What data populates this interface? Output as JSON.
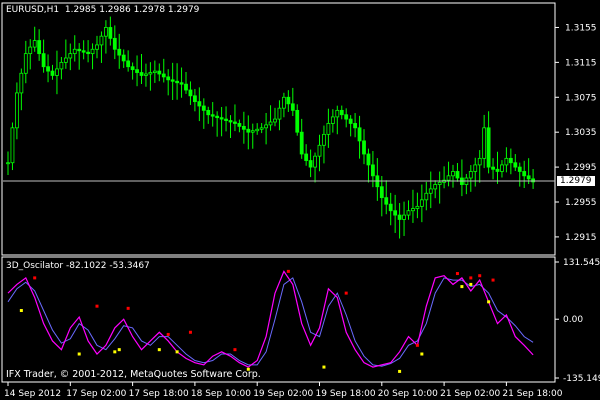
{
  "main_chart": {
    "symbol_label": "EURUSD,H1",
    "ohlc_label": "1.2985 1.2986 1.2978 1.2979",
    "price_ticks": [
      "1.3155",
      "1.3115",
      "1.3075",
      "1.3035",
      "1.2995",
      "1.2955",
      "1.2915"
    ],
    "current_price": "1.2979",
    "colors": {
      "candle": "#00ff00",
      "frame": "#ffffff",
      "price_line": "#c0c0c0"
    },
    "price_range": [
      1.29,
      1.3175
    ],
    "price_path": [
      [
        0,
        1.3
      ],
      [
        2,
        1.308
      ],
      [
        4,
        1.3125
      ],
      [
        6,
        1.314
      ],
      [
        8,
        1.311
      ],
      [
        10,
        1.31
      ],
      [
        12,
        1.3115
      ],
      [
        15,
        1.313
      ],
      [
        18,
        1.3125
      ],
      [
        20,
        1.3135
      ],
      [
        22,
        1.3155
      ],
      [
        24,
        1.313
      ],
      [
        27,
        1.311
      ],
      [
        30,
        1.31
      ],
      [
        33,
        1.3105
      ],
      [
        36,
        1.3095
      ],
      [
        39,
        1.309
      ],
      [
        42,
        1.307
      ],
      [
        45,
        1.3055
      ],
      [
        48,
        1.305
      ],
      [
        51,
        1.3045
      ],
      [
        54,
        1.3035
      ],
      [
        57,
        1.304
      ],
      [
        60,
        1.305
      ],
      [
        62,
        1.3075
      ],
      [
        64,
        1.306
      ],
      [
        66,
        1.301
      ],
      [
        68,
        1.2995
      ],
      [
        70,
        1.302
      ],
      [
        72,
        1.3045
      ],
      [
        74,
        1.306
      ],
      [
        76,
        1.305
      ],
      [
        78,
        1.304
      ],
      [
        80,
        1.301
      ],
      [
        82,
        1.2985
      ],
      [
        84,
        1.296
      ],
      [
        86,
        1.2945
      ],
      [
        88,
        1.2935
      ],
      [
        90,
        1.2945
      ],
      [
        92,
        1.295
      ],
      [
        94,
        1.2965
      ],
      [
        96,
        1.2975
      ],
      [
        98,
        1.298
      ],
      [
        100,
        1.299
      ],
      [
        102,
        1.2975
      ],
      [
        104,
        1.299
      ],
      [
        106,
        1.3005
      ],
      [
        107,
        1.304
      ],
      [
        108,
        1.2995
      ],
      [
        110,
        1.299
      ],
      [
        112,
        1.3005
      ],
      [
        114,
        1.2995
      ],
      [
        116,
        1.2985
      ],
      [
        118,
        1.2978
      ]
    ]
  },
  "indicator": {
    "title": "3D_Oscilator -82.1022 -53.3467",
    "ticks": [
      "131.5455",
      "0.00",
      "-135.1492"
    ],
    "range": [
      -135.1492,
      131.5455
    ],
    "colors": {
      "main_line": "#ff00ff",
      "signal_line": "#6a6aff",
      "buy_dot": "#ffff00",
      "sell_dot": "#ff0000"
    },
    "main_line": [
      [
        0,
        60
      ],
      [
        2,
        80
      ],
      [
        4,
        95
      ],
      [
        6,
        50
      ],
      [
        8,
        -10
      ],
      [
        10,
        -50
      ],
      [
        12,
        -70
      ],
      [
        14,
        -20
      ],
      [
        16,
        5
      ],
      [
        18,
        -50
      ],
      [
        20,
        -80
      ],
      [
        22,
        -60
      ],
      [
        24,
        -20
      ],
      [
        26,
        0
      ],
      [
        28,
        -40
      ],
      [
        30,
        -70
      ],
      [
        32,
        -50
      ],
      [
        34,
        -30
      ],
      [
        36,
        -50
      ],
      [
        38,
        -75
      ],
      [
        40,
        -90
      ],
      [
        42,
        -100
      ],
      [
        44,
        -105
      ],
      [
        46,
        -85
      ],
      [
        48,
        -75
      ],
      [
        50,
        -85
      ],
      [
        52,
        -100
      ],
      [
        54,
        -110
      ],
      [
        56,
        -95
      ],
      [
        58,
        -40
      ],
      [
        60,
        60
      ],
      [
        62,
        110
      ],
      [
        64,
        80
      ],
      [
        66,
        -10
      ],
      [
        68,
        -60
      ],
      [
        70,
        -20
      ],
      [
        72,
        70
      ],
      [
        74,
        50
      ],
      [
        76,
        -30
      ],
      [
        78,
        -70
      ],
      [
        80,
        -100
      ],
      [
        82,
        -110
      ],
      [
        84,
        -105
      ],
      [
        86,
        -100
      ],
      [
        88,
        -75
      ],
      [
        90,
        -40
      ],
      [
        92,
        -60
      ],
      [
        94,
        30
      ],
      [
        96,
        95
      ],
      [
        98,
        100
      ],
      [
        100,
        80
      ],
      [
        102,
        95
      ],
      [
        104,
        65
      ],
      [
        106,
        90
      ],
      [
        108,
        40
      ],
      [
        110,
        -10
      ],
      [
        112,
        10
      ],
      [
        114,
        -40
      ],
      [
        116,
        -60
      ],
      [
        118,
        -82
      ]
    ],
    "signal_line": [
      [
        0,
        40
      ],
      [
        2,
        70
      ],
      [
        4,
        85
      ],
      [
        6,
        65
      ],
      [
        8,
        20
      ],
      [
        10,
        -25
      ],
      [
        12,
        -55
      ],
      [
        14,
        -45
      ],
      [
        16,
        -10
      ],
      [
        18,
        -25
      ],
      [
        20,
        -60
      ],
      [
        22,
        -70
      ],
      [
        24,
        -45
      ],
      [
        26,
        -15
      ],
      [
        28,
        -20
      ],
      [
        30,
        -50
      ],
      [
        32,
        -60
      ],
      [
        34,
        -40
      ],
      [
        36,
        -40
      ],
      [
        38,
        -60
      ],
      [
        40,
        -80
      ],
      [
        42,
        -95
      ],
      [
        44,
        -100
      ],
      [
        46,
        -95
      ],
      [
        48,
        -80
      ],
      [
        50,
        -80
      ],
      [
        52,
        -95
      ],
      [
        54,
        -105
      ],
      [
        56,
        -105
      ],
      [
        58,
        -75
      ],
      [
        60,
        0
      ],
      [
        62,
        80
      ],
      [
        64,
        95
      ],
      [
        66,
        40
      ],
      [
        68,
        -30
      ],
      [
        70,
        -40
      ],
      [
        72,
        30
      ],
      [
        74,
        60
      ],
      [
        76,
        10
      ],
      [
        78,
        -50
      ],
      [
        80,
        -85
      ],
      [
        82,
        -105
      ],
      [
        84,
        -108
      ],
      [
        86,
        -102
      ],
      [
        88,
        -90
      ],
      [
        90,
        -60
      ],
      [
        92,
        -50
      ],
      [
        94,
        -10
      ],
      [
        96,
        60
      ],
      [
        98,
        95
      ],
      [
        100,
        90
      ],
      [
        102,
        90
      ],
      [
        104,
        75
      ],
      [
        106,
        80
      ],
      [
        108,
        60
      ],
      [
        110,
        20
      ],
      [
        112,
        5
      ],
      [
        114,
        -15
      ],
      [
        116,
        -40
      ],
      [
        118,
        -53
      ]
    ],
    "sell_dots": [
      [
        6,
        95
      ],
      [
        20,
        30
      ],
      [
        27,
        25
      ],
      [
        36,
        -35
      ],
      [
        41,
        -30
      ],
      [
        51,
        -70
      ],
      [
        63,
        110
      ],
      [
        76,
        60
      ],
      [
        92,
        -60
      ],
      [
        101,
        105
      ],
      [
        104,
        95
      ],
      [
        106,
        100
      ],
      [
        109,
        90
      ]
    ],
    "buy_dots": [
      [
        3,
        20
      ],
      [
        16,
        -80
      ],
      [
        24,
        -75
      ],
      [
        25,
        -70
      ],
      [
        34,
        -70
      ],
      [
        38,
        -75
      ],
      [
        54,
        -115
      ],
      [
        71,
        -110
      ],
      [
        88,
        -120
      ],
      [
        93,
        -80
      ],
      [
        102,
        75
      ],
      [
        104,
        80
      ],
      [
        108,
        40
      ]
    ]
  },
  "time_axis": {
    "labels": [
      {
        "i": 0,
        "text": "14 Sep 2012"
      },
      {
        "i": 14,
        "text": "17 Sep 02:00"
      },
      {
        "i": 28,
        "text": "17 Sep 18:00"
      },
      {
        "i": 42,
        "text": "18 Sep 10:00"
      },
      {
        "i": 56,
        "text": "19 Sep 02:00"
      },
      {
        "i": 70,
        "text": "19 Sep 18:00"
      },
      {
        "i": 84,
        "text": "20 Sep 10:00"
      },
      {
        "i": 98,
        "text": "21 Sep 02:00"
      },
      {
        "i": 112,
        "text": "21 Sep 18:00"
      }
    ]
  },
  "copyright": "IFX Trader, © 2001-2012, MetaQuotes Software Corp."
}
